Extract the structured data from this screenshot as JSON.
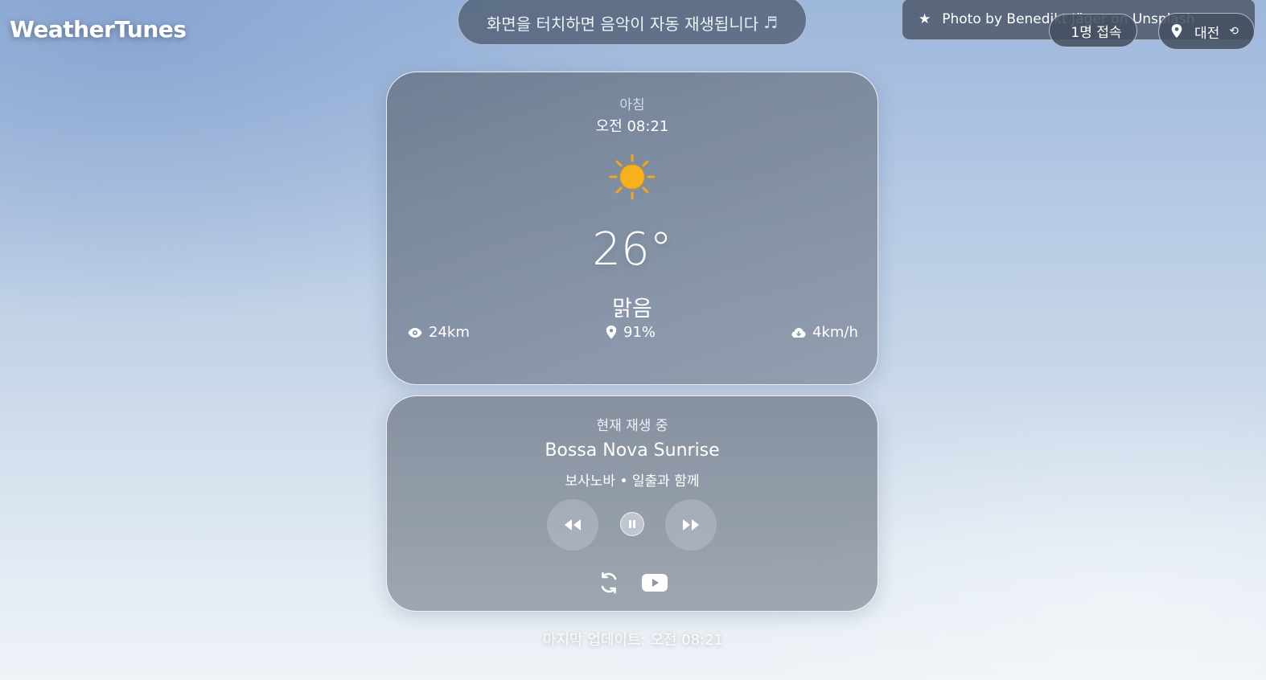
{
  "app": {
    "title": "WeatherTunes"
  },
  "banner": {
    "tip": "화면을 터치하면 음악이 자동 재생됩니다",
    "tip_icon": "music-note-icon"
  },
  "credit": {
    "text": "Photo by Benedikt Jäger on Unsplash",
    "icon": "star-icon"
  },
  "viewers": {
    "text": "1명 접속"
  },
  "location": {
    "city": "대전",
    "icon": "map-pin-icon",
    "refresh_icon": "refresh-icon"
  },
  "weather": {
    "period": "아침",
    "time": "오전 08:21",
    "icon": "sun-icon",
    "temperature": "26°",
    "condition": "맑음",
    "visibility": "24km",
    "humidity": "91%",
    "wind": "4km/h"
  },
  "player": {
    "heading": "현재 재생 중",
    "title": "Bossa Nova Sunrise",
    "subtitle": "보사노바 • 일출과 함께",
    "controls": [
      "rewind-icon",
      "pause-icon",
      "fast-forward-icon"
    ],
    "extras": [
      "shuffle-icon",
      "youtube-icon"
    ]
  },
  "footer": {
    "last_update": "마지막 업데이트: 오전 08:21"
  },
  "colors": {
    "card_bg": "#7c889c",
    "pill_bg": "#485468",
    "text": "#ffffff",
    "sun": "#f6b21a"
  }
}
